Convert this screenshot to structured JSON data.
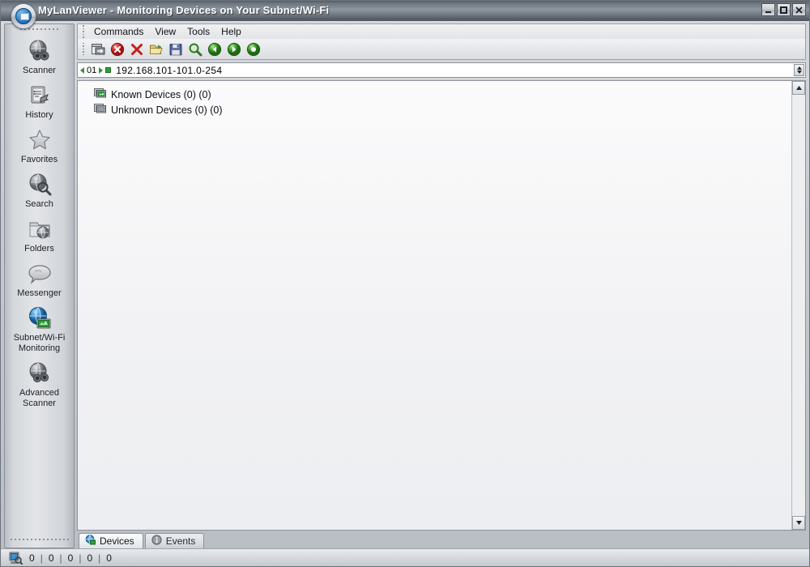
{
  "window": {
    "title": "MyLanViewer - Monitoring Devices on Your Subnet/Wi-Fi",
    "app_icon": "mylanviewer-icon",
    "controls": {
      "minimize": "minimize-icon",
      "maximize": "maximize-icon",
      "close": "close-icon"
    }
  },
  "sidebar": {
    "items": [
      {
        "label": "Scanner",
        "icon": "globe-binoculars-icon"
      },
      {
        "label": "History",
        "icon": "history-clipboard-icon"
      },
      {
        "label": "Favorites",
        "icon": "star-icon"
      },
      {
        "label": "Search",
        "icon": "globe-magnifier-icon"
      },
      {
        "label": "Folders",
        "icon": "folder-globe-icon"
      },
      {
        "label": "Messenger",
        "icon": "speech-bubble-icon"
      },
      {
        "label": "Subnet/Wi-Fi\nMonitoring",
        "label_line1": "Subnet/Wi-Fi",
        "label_line2": "Monitoring",
        "icon": "globe-monitor-icon"
      },
      {
        "label": "Advanced\nScanner",
        "label_line1": "Advanced",
        "label_line2": "Scanner",
        "icon": "globe-scanner-icon"
      }
    ]
  },
  "menu": {
    "items": [
      {
        "label": "Commands"
      },
      {
        "label": "View"
      },
      {
        "label": "Tools"
      },
      {
        "label": "Help"
      }
    ]
  },
  "toolbar": {
    "buttons": [
      {
        "name": "new-scan-button",
        "icon": "window-arrow-icon"
      },
      {
        "name": "stop-button",
        "icon": "red-circle-x-icon"
      },
      {
        "name": "delete-button",
        "icon": "red-x-icon"
      },
      {
        "name": "open-button",
        "icon": "open-folder-icon"
      },
      {
        "name": "save-button",
        "icon": "floppy-disk-icon"
      },
      {
        "name": "find-button",
        "icon": "magnifier-icon"
      },
      {
        "name": "back-button",
        "icon": "green-left-arrow-icon"
      },
      {
        "name": "forward-button",
        "icon": "green-right-arrow-icon"
      },
      {
        "name": "refresh-button",
        "icon": "green-circle-icon"
      }
    ]
  },
  "address": {
    "counter": "01",
    "value": "192.168.101-101.0-254",
    "prefix_left_icon": "left-triangle-icon",
    "prefix_right_icon": "right-triangle-icon",
    "status_icon": "green-square-icon",
    "spinner": "spinner-updown-icon"
  },
  "tree": {
    "nodes": [
      {
        "label": "Known Devices (0) (0)",
        "icon": "monitor-green-icon"
      },
      {
        "label": "Unknown Devices (0) (0)",
        "icon": "monitor-gray-icon"
      }
    ]
  },
  "scrollbar": {
    "up_icon": "scroll-up-icon",
    "down_icon": "scroll-down-icon"
  },
  "tabs": [
    {
      "label": "Devices",
      "icon": "devices-globe-icon",
      "active": true
    },
    {
      "label": "Events",
      "icon": "info-icon",
      "active": false
    }
  ],
  "statusbar": {
    "icon": "scan-monitor-icon",
    "counters": [
      "0",
      "0",
      "0",
      "0",
      "0"
    ],
    "separator": "|"
  },
  "colors": {
    "titlebar_text": "#ffffff",
    "accent_green": "#2f9e3a",
    "accent_red": "#cc2222",
    "accent_blue": "#2a7dc4",
    "panel_bg": "#f4f4f6",
    "chrome_bg": "#d4d7db"
  }
}
